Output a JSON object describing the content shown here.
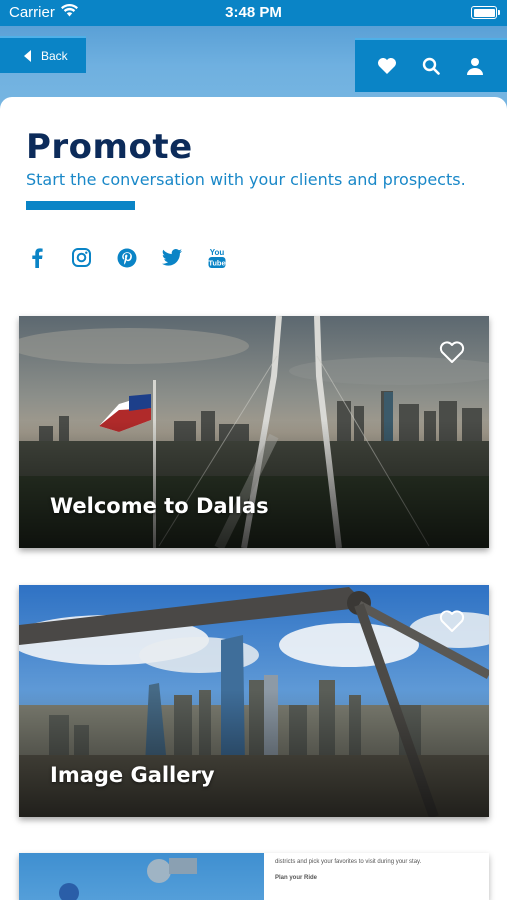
{
  "status_bar": {
    "carrier": "Carrier",
    "time": "3:48 PM"
  },
  "nav": {
    "back_label": "Back"
  },
  "page": {
    "title": "Promote",
    "subtitle": "Start the conversation with your clients and prospects."
  },
  "social": [
    "facebook-icon",
    "instagram-icon",
    "pinterest-icon",
    "twitter-icon",
    "youtube-icon"
  ],
  "cards": [
    {
      "label": "Welcome to Dallas"
    },
    {
      "label": "Image Gallery"
    }
  ],
  "card3": {
    "line1": "districts and pick your favorites to visit during your stay.",
    "line2": "Plan your Ride"
  },
  "colors": {
    "accent": "#0a84c6",
    "title": "#0c2b5a",
    "subtitle": "#1a88c8"
  }
}
